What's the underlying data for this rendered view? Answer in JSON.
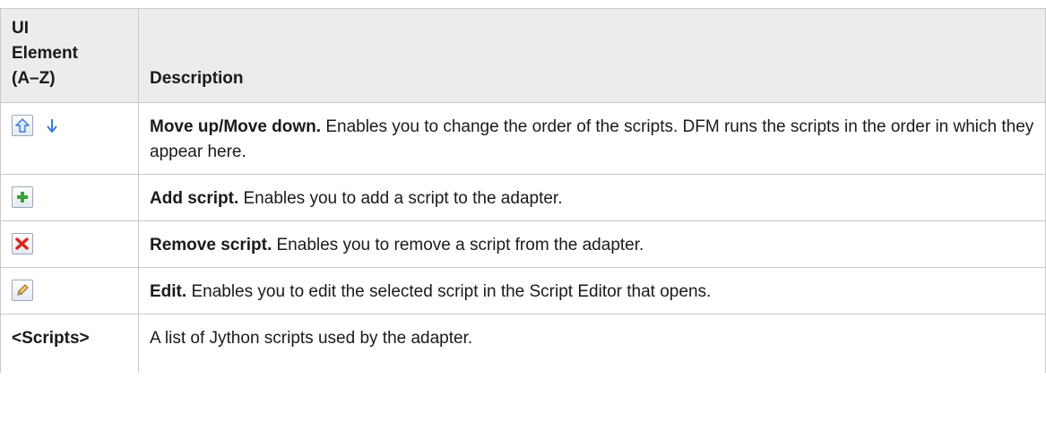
{
  "table": {
    "headers": {
      "element_line1": "UI",
      "element_line2": "Element",
      "element_line3": "(A–Z)",
      "description": "Description"
    },
    "rows": [
      {
        "icons": [
          "move-up-icon",
          "move-down-icon"
        ],
        "title": "Move up/Move down.",
        "text": " Enables you to change the order of the scripts. DFM runs the scripts in the order in which they appear here."
      },
      {
        "icons": [
          "add-icon"
        ],
        "title": "Add script.",
        "text": " Enables you to add a script to the adapter."
      },
      {
        "icons": [
          "remove-icon"
        ],
        "title": "Remove script.",
        "text": " Enables you to remove a script from the adapter."
      },
      {
        "icons": [
          "edit-pencil-icon"
        ],
        "title": "Edit.",
        "text": " Enables you to edit the selected script in the Script Editor that opens."
      },
      {
        "element": "<Scripts>",
        "text": "A list of Jython scripts used by the adapter."
      }
    ]
  },
  "colors": {
    "header_bg": "#ececec",
    "border": "#c8c8c8",
    "arrow_blue": "#3b78d8",
    "add_green": "#3aa23a",
    "remove_red": "#d9261c"
  }
}
